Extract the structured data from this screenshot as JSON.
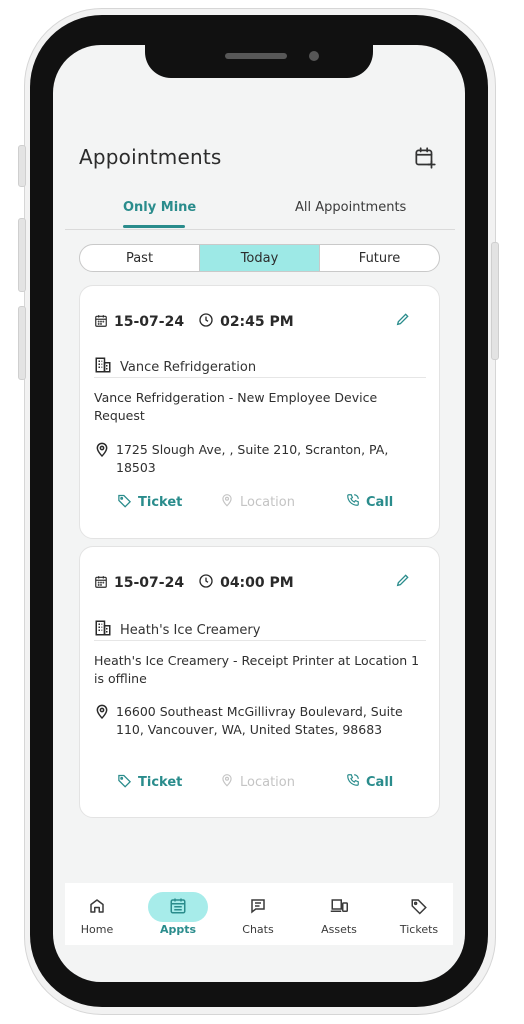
{
  "header": {
    "title": "Appointments",
    "add_icon": "calendar-plus-icon"
  },
  "tabs": {
    "active": "Only Mine",
    "inactive": "All Appointments"
  },
  "segments": {
    "past": "Past",
    "today": "Today",
    "future": "Future"
  },
  "appointments": [
    {
      "date": "15-07-24",
      "time": "02:45 PM",
      "company": "Vance Refridgeration",
      "description": "Vance Refridgeration - New Employee Device Request",
      "address": "1725 Slough Ave, , Suite 210, Scranton, PA, 18503",
      "actions": {
        "ticket": "Ticket",
        "location": "Location",
        "call": "Call"
      }
    },
    {
      "date": "15-07-24",
      "time": "04:00 PM",
      "company": "Heath's Ice Creamery",
      "description": "Heath's Ice Creamery - Receipt Printer at Location 1 is offline",
      "address": "16600 Southeast McGillivray Boulevard, Suite 110, Vancouver, WA, United States, 98683",
      "actions": {
        "ticket": "Ticket",
        "location": "Location",
        "call": "Call"
      }
    }
  ],
  "nav": [
    {
      "label": "Home",
      "icon": "home-icon"
    },
    {
      "label": "Appts",
      "icon": "calendar-icon"
    },
    {
      "label": "Chats",
      "icon": "chat-icon"
    },
    {
      "label": "Assets",
      "icon": "devices-icon"
    },
    {
      "label": "Tickets",
      "icon": "tag-icon"
    }
  ],
  "colors": {
    "accent": "#2a8c8c",
    "highlight": "#9de9e6",
    "disabled": "#c4c4c4"
  }
}
